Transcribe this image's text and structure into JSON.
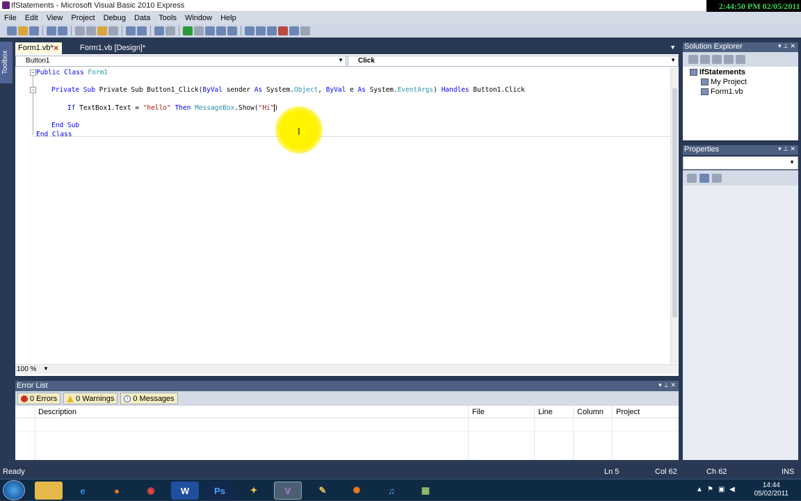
{
  "window": {
    "title": "IfStatements - Microsoft Visual Basic 2010 Express",
    "overlay_clock": "2:44:50 PM 02/05/2011"
  },
  "menu": [
    "File",
    "Edit",
    "View",
    "Project",
    "Debug",
    "Data",
    "Tools",
    "Window",
    "Help"
  ],
  "toolbox_strip": "Toolbox",
  "doc_tabs": {
    "active": "Form1.vb*",
    "inactive": "Form1.vb [Design]*"
  },
  "nav": {
    "object": "Button1",
    "event": "Click"
  },
  "code": {
    "l1_kw": "Public Class",
    "l1_name": "Form1",
    "l2_a": "Private Sub Button1_Click(",
    "l2_byval1": "ByVal",
    "l2_b": " sender ",
    "l2_as1": "As",
    "l2_c": " System.",
    "l2_obj": "Object",
    "l2_d": ", ",
    "l2_byval2": "ByVal",
    "l2_e": " e ",
    "l2_as2": "As",
    "l2_f": " System.",
    "l2_ev": "EventArgs",
    "l2_g": ") ",
    "l2_handles": "Handles",
    "l2_h": " Button1.Click",
    "l3_if": "If",
    "l3_a": " TextBox1.Text = ",
    "l3_s1": "\"hello\"",
    "l3_then": " Then ",
    "l3_mb": "MessageBox",
    "l3_b": ".Show(",
    "l3_s2": "\"Hi\"",
    "l3_c": ")",
    "l4": "End Sub",
    "l5": "End Class"
  },
  "zoom": "100 %",
  "error_list": {
    "title": "Error List",
    "errors": "0 Errors",
    "warnings": "0 Warnings",
    "messages": "0 Messages",
    "columns": [
      "Description",
      "File",
      "Line",
      "Column",
      "Project"
    ]
  },
  "solution_explorer": {
    "title": "Solution Explorer",
    "solution": "IfStatements",
    "items": [
      "My Project",
      "Form1.vb"
    ]
  },
  "properties": {
    "title": "Properties"
  },
  "status": {
    "ready": "Ready",
    "ln": "Ln 5",
    "col": "Col 62",
    "ch": "Ch 62",
    "ins": "INS"
  },
  "taskbar": {
    "time": "14:44",
    "date": "05/02/2011",
    "apps": [
      "explorer",
      "ie",
      "firefox",
      "chrome",
      "word",
      "photoshop",
      "app7",
      "visual-basic",
      "app9",
      "avast",
      "itunes",
      "app12"
    ]
  }
}
